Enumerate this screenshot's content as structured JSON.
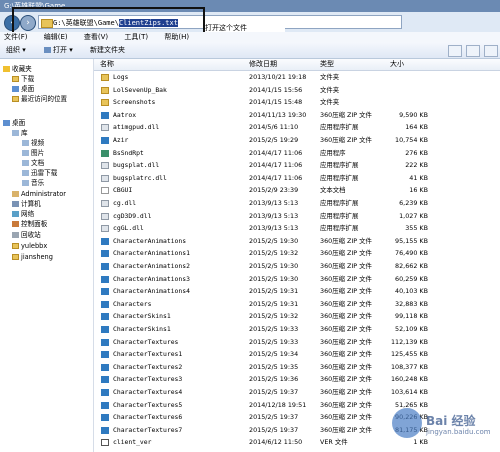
{
  "window": {
    "title": "G:\\英雄联盟\\Game"
  },
  "address": {
    "path_prefix": "G:\\英雄联盟\\Game\\",
    "path_selected": "ClientZips.txt"
  },
  "tooltip": "打开这个文件",
  "menu": [
    "文件(F)",
    "编辑(E)",
    "查看(V)",
    "工具(T)",
    "帮助(H)"
  ],
  "toolbar": {
    "organize": "组织 ▾",
    "open": "打开 ▾",
    "new_folder": "新建文件夹"
  },
  "nav": [
    {
      "label": "收藏夹",
      "icon": "star-icon",
      "indent": 0
    },
    {
      "label": "下载",
      "icon": "folder-icon",
      "indent": 1
    },
    {
      "label": "桌面",
      "icon": "desktop-icon",
      "indent": 1
    },
    {
      "label": "最近访问的位置",
      "icon": "recent-icon",
      "indent": 1
    },
    {
      "label": "",
      "icon": "",
      "indent": 0
    },
    {
      "label": "桌面",
      "icon": "desktop-icon",
      "indent": 0
    },
    {
      "label": "库",
      "icon": "library-icon",
      "indent": 1
    },
    {
      "label": "视频",
      "icon": "video-icon",
      "indent": 2
    },
    {
      "label": "图片",
      "icon": "picture-icon",
      "indent": 2
    },
    {
      "label": "文档",
      "icon": "document-icon",
      "indent": 2
    },
    {
      "label": "迅雷下载",
      "icon": "download-icon",
      "indent": 2
    },
    {
      "label": "音乐",
      "icon": "music-icon",
      "indent": 2
    },
    {
      "label": "Administrator",
      "icon": "user-icon",
      "indent": 1
    },
    {
      "label": "计算机",
      "icon": "computer-icon",
      "indent": 1
    },
    {
      "label": "网络",
      "icon": "network-icon",
      "indent": 1
    },
    {
      "label": "控制面板",
      "icon": "control-panel-icon",
      "indent": 1
    },
    {
      "label": "回收站",
      "icon": "recycle-bin-icon",
      "indent": 1
    },
    {
      "label": "yulebbx",
      "icon": "folder-icon",
      "indent": 1
    },
    {
      "label": "jiansheng",
      "icon": "folder-icon",
      "indent": 1
    }
  ],
  "columns": {
    "name": "名称",
    "date": "修改日期",
    "type": "类型",
    "size": "大小"
  },
  "files": [
    {
      "name": "Logs",
      "date": "2013/10/21 19:18",
      "type": "文件夹",
      "size": "",
      "icon": "folder"
    },
    {
      "name": "LolSevenUp_Bak",
      "date": "2014/1/15 15:56",
      "type": "文件夹",
      "size": "",
      "icon": "folder"
    },
    {
      "name": "Screenshots",
      "date": "2014/1/15 15:48",
      "type": "文件夹",
      "size": "",
      "icon": "folder"
    },
    {
      "name": "Aatrox",
      "date": "2014/11/13 19:30",
      "type": "360压缩 ZIP 文件",
      "size": "9,590 KB",
      "icon": "zip"
    },
    {
      "name": "atimgpud.dll",
      "date": "2014/5/6 11:10",
      "type": "应用程序扩展",
      "size": "164 KB",
      "icon": "dll"
    },
    {
      "name": "Azir",
      "date": "2015/2/5 19:29",
      "type": "360压缩 ZIP 文件",
      "size": "10,754 KB",
      "icon": "zip"
    },
    {
      "name": "BsSndRpt",
      "date": "2014/4/17 11:06",
      "type": "应用程序",
      "size": "276 KB",
      "icon": "exe"
    },
    {
      "name": "bugsplat.dll",
      "date": "2014/4/17 11:06",
      "type": "应用程序扩展",
      "size": "222 KB",
      "icon": "dll"
    },
    {
      "name": "bugsplatrc.dll",
      "date": "2014/4/17 11:06",
      "type": "应用程序扩展",
      "size": "41 KB",
      "icon": "dll"
    },
    {
      "name": "CBGUI",
      "date": "2015/2/9 23:39",
      "type": "文本文档",
      "size": "16 KB",
      "icon": "cfg"
    },
    {
      "name": "cg.dll",
      "date": "2013/9/13 5:13",
      "type": "应用程序扩展",
      "size": "6,239 KB",
      "icon": "dll"
    },
    {
      "name": "cgD3D9.dll",
      "date": "2013/9/13 5:13",
      "type": "应用程序扩展",
      "size": "1,027 KB",
      "icon": "dll"
    },
    {
      "name": "cgGL.dll",
      "date": "2013/9/13 5:13",
      "type": "应用程序扩展",
      "size": "355 KB",
      "icon": "dll"
    },
    {
      "name": "CharacterAnimations",
      "date": "2015/2/5 19:30",
      "type": "360压缩 ZIP 文件",
      "size": "95,155 KB",
      "icon": "zip"
    },
    {
      "name": "CharacterAnimations1",
      "date": "2015/2/5 19:32",
      "type": "360压缩 ZIP 文件",
      "size": "76,490 KB",
      "icon": "zip"
    },
    {
      "name": "CharacterAnimations2",
      "date": "2015/2/5 19:30",
      "type": "360压缩 ZIP 文件",
      "size": "82,662 KB",
      "icon": "zip"
    },
    {
      "name": "CharacterAnimations3",
      "date": "2015/2/5 19:30",
      "type": "360压缩 ZIP 文件",
      "size": "60,259 KB",
      "icon": "zip"
    },
    {
      "name": "CharacterAnimations4",
      "date": "2015/2/5 19:31",
      "type": "360压缩 ZIP 文件",
      "size": "40,103 KB",
      "icon": "zip"
    },
    {
      "name": "Characters",
      "date": "2015/2/5 19:31",
      "type": "360压缩 ZIP 文件",
      "size": "32,883 KB",
      "icon": "zip"
    },
    {
      "name": "CharacterSkins1",
      "date": "2015/2/5 19:32",
      "type": "360压缩 ZIP 文件",
      "size": "99,118 KB",
      "icon": "zip"
    },
    {
      "name": "CharacterSkins1",
      "date": "2015/2/5 19:33",
      "type": "360压缩 ZIP 文件",
      "size": "52,109 KB",
      "icon": "zip"
    },
    {
      "name": "CharacterTextures",
      "date": "2015/2/5 19:33",
      "type": "360压缩 ZIP 文件",
      "size": "112,139 KB",
      "icon": "zip"
    },
    {
      "name": "CharacterTextures1",
      "date": "2015/2/5 19:34",
      "type": "360压缩 ZIP 文件",
      "size": "125,455 KB",
      "icon": "zip"
    },
    {
      "name": "CharacterTextures2",
      "date": "2015/2/5 19:35",
      "type": "360压缩 ZIP 文件",
      "size": "108,377 KB",
      "icon": "zip"
    },
    {
      "name": "CharacterTextures3",
      "date": "2015/2/5 19:36",
      "type": "360压缩 ZIP 文件",
      "size": "160,248 KB",
      "icon": "zip"
    },
    {
      "name": "CharacterTextures4",
      "date": "2015/2/5 19:37",
      "type": "360压缩 ZIP 文件",
      "size": "103,614 KB",
      "icon": "zip"
    },
    {
      "name": "CharacterTextures5",
      "date": "2014/12/18 19:51",
      "type": "360压缩 ZIP 文件",
      "size": "51,265 KB",
      "icon": "zip"
    },
    {
      "name": "CharacterTextures6",
      "date": "2015/2/5 19:37",
      "type": "360压缩 ZIP 文件",
      "size": "90,226 KB",
      "icon": "zip"
    },
    {
      "name": "CharacterTextures7",
      "date": "2015/2/5 19:37",
      "type": "360压缩 ZIP 文件",
      "size": "81,175 KB",
      "icon": "zip"
    },
    {
      "name": "client_ver",
      "date": "2014/6/12 11:50",
      "type": "VER 文件",
      "size": "1 KB",
      "icon": "txt"
    }
  ],
  "watermark": {
    "brand": "Bai 经验",
    "sub": "jingyan.baidu.com"
  }
}
